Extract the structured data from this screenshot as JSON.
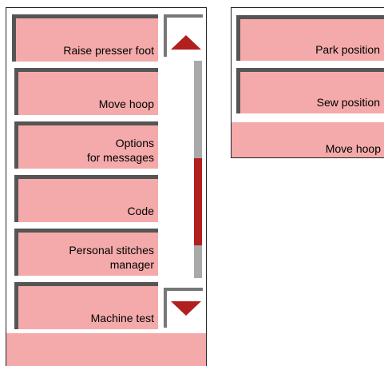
{
  "left_menu": {
    "items": [
      {
        "label": "Raise presser foot"
      },
      {
        "label": "Move hoop"
      },
      {
        "label": "Options\nfor messages"
      },
      {
        "label": "Code"
      },
      {
        "label": "Personal stitches\nmanager"
      },
      {
        "label": "Machine test"
      }
    ],
    "scrollbar": {
      "position_fraction": 0.45,
      "visible_fraction": 0.4
    }
  },
  "right_menu": {
    "items": [
      {
        "label": "Park position"
      },
      {
        "label": "Sew position"
      },
      {
        "label": "Move hoop"
      }
    ]
  },
  "colors": {
    "button_fill": "#f4aaaa",
    "button_shadow": "#555555",
    "accent_red": "#b11f1f",
    "scroll_track": "#a9a9a9"
  },
  "icons": {
    "scroll_up": "triangle-up-icon",
    "scroll_down": "triangle-down-icon"
  }
}
